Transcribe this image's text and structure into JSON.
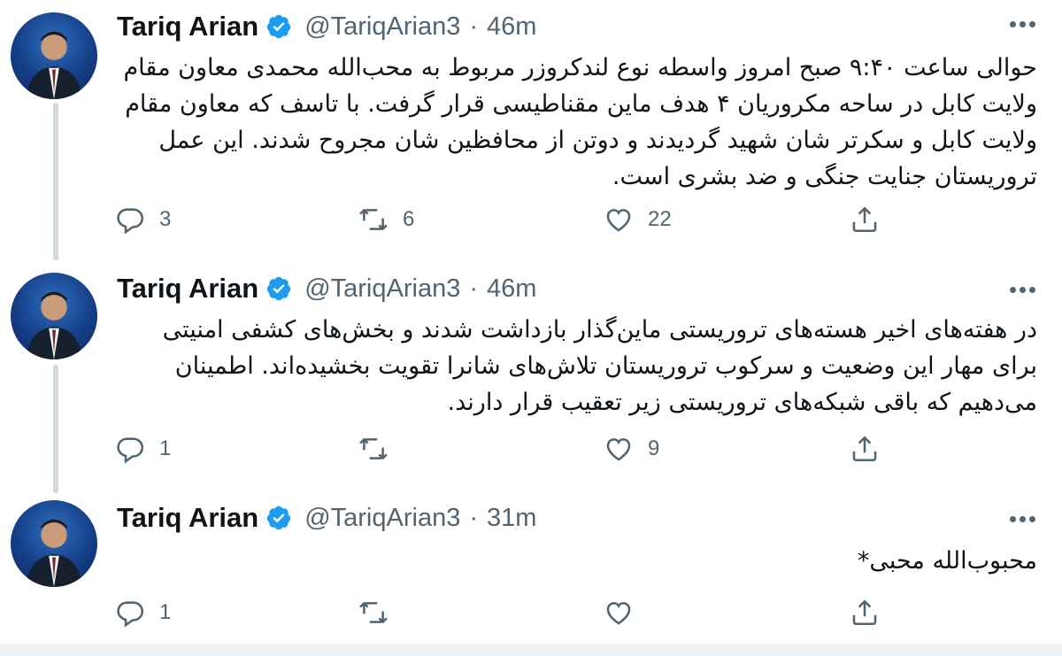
{
  "tweets": [
    {
      "name": "Tariq Arian",
      "handle": "@TariqArian3",
      "separator": "·",
      "time": "46m",
      "text": "حوالی ساعت ۹:۴۰ صبح امروز واسطه نوع لندکروزر مربوط به محب‌الله محمدی معاون مقام ولایت کابل در ساحه مکروریان ۴ هدف ماین مقناطیسی قرار گرفت. با تاسف که معاون مقام ولایت کابل و سکرتر شان شهید گردیدند و دوتن از محافظین شان مجروح شدند. این عمل تروریستان جنایت جنگی و ضد بشری است.",
      "replies": "3",
      "retweets": "6",
      "likes": "22"
    },
    {
      "name": "Tariq Arian",
      "handle": "@TariqArian3",
      "separator": "·",
      "time": "46m",
      "text": "در هفته‌های اخیر هسته‌های تروریستی ماین‌گذار بازداشت شدند و بخش‌های کشفی امنیتی برای مهار این وضعیت و سرکوب تروریستان تلاش‌های شانرا تقویت بخشیده‌اند. اطمینان می‌دهیم که باقی شبکه‌های تروریستی زیر تعقیب قرار دارند.",
      "replies": "1",
      "retweets": "",
      "likes": "9"
    },
    {
      "name": "Tariq Arian",
      "handle": "@TariqArian3",
      "separator": "·",
      "time": "31m",
      "text": "محبوب‌الله محبی*",
      "replies": "1",
      "retweets": "",
      "likes": ""
    }
  ],
  "icons": {
    "verified": "verified-badge-icon",
    "more": "more-options-icon",
    "reply": "reply-icon",
    "retweet": "retweet-icon",
    "like": "heart-icon",
    "share": "share-icon"
  },
  "colors": {
    "accent": "#1d9bf0",
    "muted": "#536471",
    "thread_line": "#cfd9de"
  }
}
